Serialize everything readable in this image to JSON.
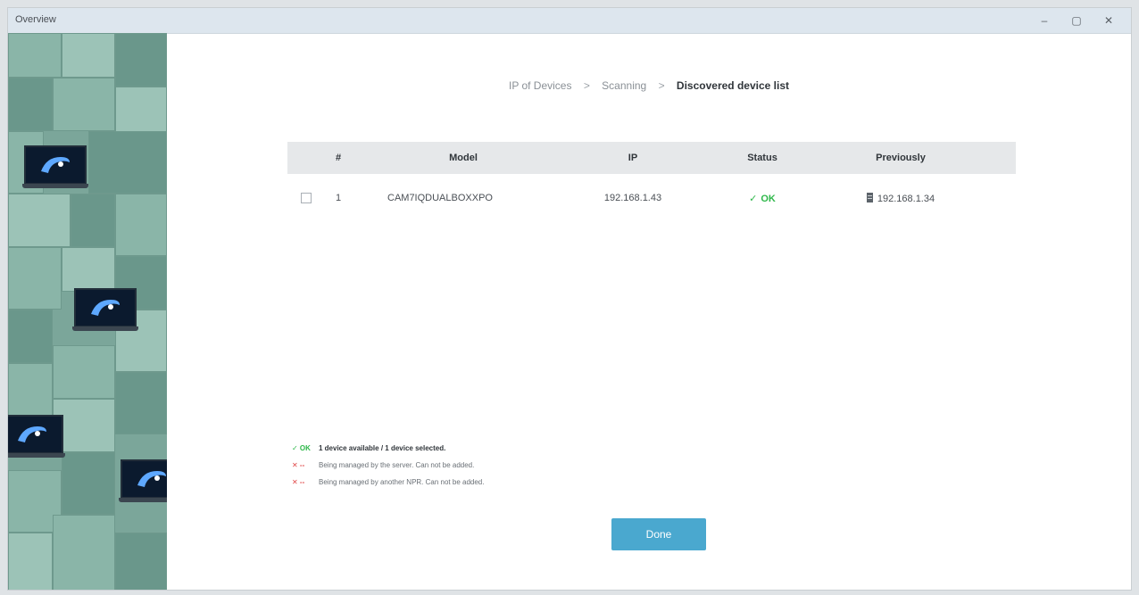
{
  "window": {
    "title": "Overview",
    "min_glyph": "–",
    "max_glyph": "▢",
    "close_glyph": "✕"
  },
  "breadcrumb": {
    "steps": [
      "IP of Devices",
      "Scanning",
      "Discovered device list"
    ],
    "separator": ">"
  },
  "table": {
    "headers": {
      "number": "#",
      "model": "Model",
      "ip": "IP",
      "status": "Status",
      "previously": "Previously"
    },
    "rows": [
      {
        "number": "1",
        "model": "CAM7IQDUALBOXXPO",
        "ip": "192.168.1.43",
        "status_mark": "✓",
        "status": "OK",
        "previously": "192.168.1.34"
      }
    ]
  },
  "legend": {
    "items": [
      {
        "mark": "✓ OK",
        "text": "1 device available / 1 device selected.",
        "color": "#2eb84a"
      },
      {
        "mark": "✕ --",
        "text": "Being managed by the server. Can not be added.",
        "color": "#e04848"
      },
      {
        "mark": "✕ --",
        "text": "Being managed by another NPR. Can not be added.",
        "color": "#e04848"
      }
    ]
  },
  "done_label": "Done",
  "icons": {
    "server": "server-icon",
    "laptop_logo": "brand-logo-icon"
  },
  "colors": {
    "accent": "#4aa8cf",
    "ok": "#2eb84a",
    "error": "#e04848",
    "side_panel": "#7ba69a"
  }
}
